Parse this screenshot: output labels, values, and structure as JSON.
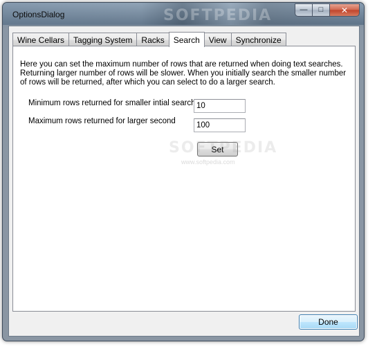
{
  "window": {
    "title": "OptionsDialog",
    "watermark": "SOFTPEDIA"
  },
  "caption_buttons": {
    "minimize_glyph": "—",
    "maximize_glyph": "□",
    "close_glyph": "✕"
  },
  "tabs": [
    {
      "label": "Wine Cellars",
      "active": false
    },
    {
      "label": "Tagging System",
      "active": false
    },
    {
      "label": "Racks",
      "active": false
    },
    {
      "label": "Search",
      "active": true
    },
    {
      "label": "View",
      "active": false
    },
    {
      "label": "Synchronize",
      "active": false
    }
  ],
  "search_tab": {
    "description": "Here you can set the maximum number of rows that are returned when doing text searches. Returning larger number of rows will be slower. When you initially search the smaller number of rows will be returned, after which you can select to do a larger search.",
    "min_rows_label": "Minimum rows returned for smaller intial search:",
    "min_rows_value": "10",
    "max_rows_label": "Maximum rows returned for larger second",
    "max_rows_value": "100",
    "set_button": "Set",
    "watermark": "SOFTPEDIA",
    "watermark_url": "www.softpedia.com"
  },
  "footer": {
    "done_button": "Done"
  }
}
